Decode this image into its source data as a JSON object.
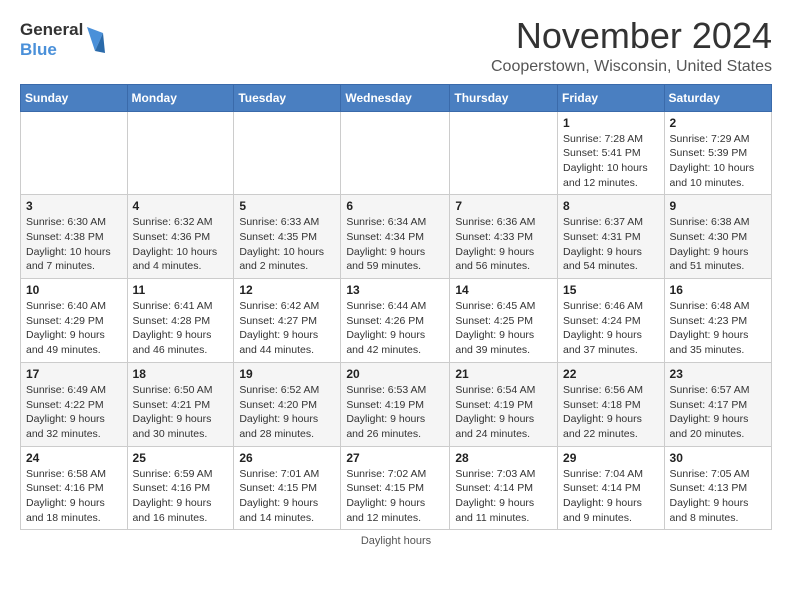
{
  "header": {
    "logo_line1": "General",
    "logo_line2": "Blue",
    "title": "November 2024",
    "subtitle": "Cooperstown, Wisconsin, United States"
  },
  "footer": {
    "note": "Daylight hours"
  },
  "calendar": {
    "headers": [
      "Sunday",
      "Monday",
      "Tuesday",
      "Wednesday",
      "Thursday",
      "Friday",
      "Saturday"
    ],
    "weeks": [
      [
        {
          "day": "",
          "info": ""
        },
        {
          "day": "",
          "info": ""
        },
        {
          "day": "",
          "info": ""
        },
        {
          "day": "",
          "info": ""
        },
        {
          "day": "",
          "info": ""
        },
        {
          "day": "1",
          "info": "Sunrise: 7:28 AM\nSunset: 5:41 PM\nDaylight: 10 hours\nand 12 minutes."
        },
        {
          "day": "2",
          "info": "Sunrise: 7:29 AM\nSunset: 5:39 PM\nDaylight: 10 hours\nand 10 minutes."
        }
      ],
      [
        {
          "day": "3",
          "info": "Sunrise: 6:30 AM\nSunset: 4:38 PM\nDaylight: 10 hours\nand 7 minutes."
        },
        {
          "day": "4",
          "info": "Sunrise: 6:32 AM\nSunset: 4:36 PM\nDaylight: 10 hours\nand 4 minutes."
        },
        {
          "day": "5",
          "info": "Sunrise: 6:33 AM\nSunset: 4:35 PM\nDaylight: 10 hours\nand 2 minutes."
        },
        {
          "day": "6",
          "info": "Sunrise: 6:34 AM\nSunset: 4:34 PM\nDaylight: 9 hours\nand 59 minutes."
        },
        {
          "day": "7",
          "info": "Sunrise: 6:36 AM\nSunset: 4:33 PM\nDaylight: 9 hours\nand 56 minutes."
        },
        {
          "day": "8",
          "info": "Sunrise: 6:37 AM\nSunset: 4:31 PM\nDaylight: 9 hours\nand 54 minutes."
        },
        {
          "day": "9",
          "info": "Sunrise: 6:38 AM\nSunset: 4:30 PM\nDaylight: 9 hours\nand 51 minutes."
        }
      ],
      [
        {
          "day": "10",
          "info": "Sunrise: 6:40 AM\nSunset: 4:29 PM\nDaylight: 9 hours\nand 49 minutes."
        },
        {
          "day": "11",
          "info": "Sunrise: 6:41 AM\nSunset: 4:28 PM\nDaylight: 9 hours\nand 46 minutes."
        },
        {
          "day": "12",
          "info": "Sunrise: 6:42 AM\nSunset: 4:27 PM\nDaylight: 9 hours\nand 44 minutes."
        },
        {
          "day": "13",
          "info": "Sunrise: 6:44 AM\nSunset: 4:26 PM\nDaylight: 9 hours\nand 42 minutes."
        },
        {
          "day": "14",
          "info": "Sunrise: 6:45 AM\nSunset: 4:25 PM\nDaylight: 9 hours\nand 39 minutes."
        },
        {
          "day": "15",
          "info": "Sunrise: 6:46 AM\nSunset: 4:24 PM\nDaylight: 9 hours\nand 37 minutes."
        },
        {
          "day": "16",
          "info": "Sunrise: 6:48 AM\nSunset: 4:23 PM\nDaylight: 9 hours\nand 35 minutes."
        }
      ],
      [
        {
          "day": "17",
          "info": "Sunrise: 6:49 AM\nSunset: 4:22 PM\nDaylight: 9 hours\nand 32 minutes."
        },
        {
          "day": "18",
          "info": "Sunrise: 6:50 AM\nSunset: 4:21 PM\nDaylight: 9 hours\nand 30 minutes."
        },
        {
          "day": "19",
          "info": "Sunrise: 6:52 AM\nSunset: 4:20 PM\nDaylight: 9 hours\nand 28 minutes."
        },
        {
          "day": "20",
          "info": "Sunrise: 6:53 AM\nSunset: 4:19 PM\nDaylight: 9 hours\nand 26 minutes."
        },
        {
          "day": "21",
          "info": "Sunrise: 6:54 AM\nSunset: 4:19 PM\nDaylight: 9 hours\nand 24 minutes."
        },
        {
          "day": "22",
          "info": "Sunrise: 6:56 AM\nSunset: 4:18 PM\nDaylight: 9 hours\nand 22 minutes."
        },
        {
          "day": "23",
          "info": "Sunrise: 6:57 AM\nSunset: 4:17 PM\nDaylight: 9 hours\nand 20 minutes."
        }
      ],
      [
        {
          "day": "24",
          "info": "Sunrise: 6:58 AM\nSunset: 4:16 PM\nDaylight: 9 hours\nand 18 minutes."
        },
        {
          "day": "25",
          "info": "Sunrise: 6:59 AM\nSunset: 4:16 PM\nDaylight: 9 hours\nand 16 minutes."
        },
        {
          "day": "26",
          "info": "Sunrise: 7:01 AM\nSunset: 4:15 PM\nDaylight: 9 hours\nand 14 minutes."
        },
        {
          "day": "27",
          "info": "Sunrise: 7:02 AM\nSunset: 4:15 PM\nDaylight: 9 hours\nand 12 minutes."
        },
        {
          "day": "28",
          "info": "Sunrise: 7:03 AM\nSunset: 4:14 PM\nDaylight: 9 hours\nand 11 minutes."
        },
        {
          "day": "29",
          "info": "Sunrise: 7:04 AM\nSunset: 4:14 PM\nDaylight: 9 hours\nand 9 minutes."
        },
        {
          "day": "30",
          "info": "Sunrise: 7:05 AM\nSunset: 4:13 PM\nDaylight: 9 hours\nand 8 minutes."
        }
      ]
    ]
  }
}
